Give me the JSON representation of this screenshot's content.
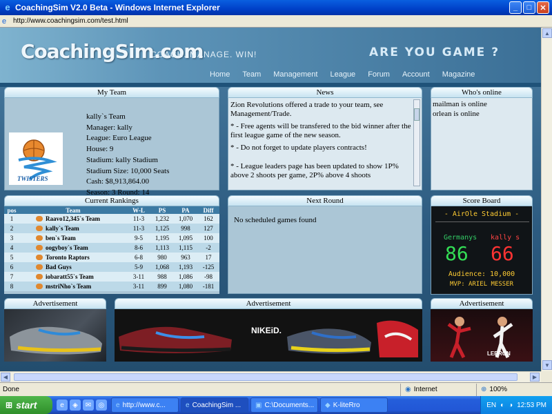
{
  "window": {
    "title": "CoachingSim V2.0 Beta - Windows Internet Explorer",
    "address": "http://www.coachingsim.com/test.html"
  },
  "site": {
    "logo": "CoachingSim.com",
    "tagline": "COACH.    MANAGE.    WIN!",
    "slogan": "ARE YOU GAME ?",
    "nav": [
      "Home",
      "Team",
      "Management",
      "League",
      "Forum",
      "Account",
      "Magazine"
    ]
  },
  "my_team": {
    "header": "My Team",
    "lines": [
      "kally`s Team",
      "Manager: kally",
      "League: Euro League",
      "House: 9",
      "Stadium: kally Stadium",
      "Stadium Size: 10,000 Seats",
      "Cash: $8,913,864.00",
      "Season: 3  Round: 14"
    ],
    "logo_text": "TWISTERS"
  },
  "news": {
    "header": "News",
    "items": [
      "Zion Revolutions offered a trade to your team, see Management/Trade.",
      "* - Free agents will be transfered to the bid winner after the first league game of the new season.",
      "* - Do not forget to update players contracts!",
      "",
      "* - League leaders page has been updated to show 1P% above 2 shoots per game, 2P% above 4 shoots"
    ]
  },
  "whos_online": {
    "header": "Who's online",
    "users": [
      "mailman is online",
      "orlean is online"
    ]
  },
  "rankings": {
    "header": "Current Rankings",
    "columns": [
      "pos",
      "Team",
      "W-L",
      "PS",
      "PA",
      "Diff"
    ],
    "rows": [
      [
        "1",
        "Raavo12,345`s Team",
        "11-3",
        "1,232",
        "1,070",
        "162"
      ],
      [
        "2",
        "kally`s Team",
        "11-3",
        "1,125",
        "998",
        "127"
      ],
      [
        "3",
        "ben`s Team",
        "9-5",
        "1,195",
        "1,095",
        "100"
      ],
      [
        "4",
        "oogyboy`s Team",
        "8-6",
        "1,113",
        "1,115",
        "-2"
      ],
      [
        "5",
        "Toronto Raptors",
        "6-8",
        "980",
        "963",
        "17"
      ],
      [
        "6",
        "Bad Guys",
        "5-9",
        "1,068",
        "1,193",
        "-125"
      ],
      [
        "7",
        "iobaratt55`s Team",
        "3-11",
        "988",
        "1,086",
        "-98"
      ],
      [
        "8",
        "mstriNho`s Team",
        "3-11",
        "899",
        "1,080",
        "-181"
      ]
    ]
  },
  "next_round": {
    "header": "Next Round",
    "text": "No scheduled games found"
  },
  "score_board": {
    "header": "Score Board",
    "stadium": "- AirOle Stadium -",
    "team1": "Germanys",
    "team2": "kally s",
    "score1": "86",
    "score2": "66",
    "audience": "Audience: 10,000",
    "mvp": "MVP: ARIEL MESSER"
  },
  "ads": {
    "left": "Advertisement",
    "center": "Advertisement",
    "right": "Advertisement",
    "nike_label": "NIKEiD.",
    "lebron_label": "LEBRON"
  },
  "status": {
    "left": "Done",
    "zone": "Internet",
    "zoom": "100%"
  },
  "taskbar": {
    "start": "start",
    "tasks": [
      "http://www.c...",
      "CoachingSim ...",
      "C:\\Documents...",
      "K-liteRro"
    ],
    "lang": "EN",
    "time": "12:53 PM"
  },
  "colors": {
    "header_accent": "#3c7aa3",
    "panel_bg": "#abc6d6",
    "score_green": "#33dd55",
    "score_red": "#ff3333"
  }
}
